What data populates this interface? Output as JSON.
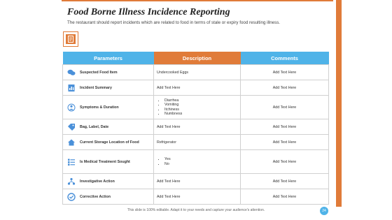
{
  "title": "Food Borne Illness Incidence Reporting",
  "subtitle": "The restaurant should report incidents which are related to food in terms of stale or expiry food resulting illness.",
  "header_icon": "document-icon",
  "colors": {
    "accent_orange": "#e07b39",
    "accent_blue": "#4fb3e8"
  },
  "table": {
    "headers": {
      "parameters": "Parameters",
      "description": "Description",
      "comments": "Comments"
    },
    "rows": [
      {
        "icon": "chat-bubbles-icon",
        "parameter": "Suspected Food Item",
        "description": "Undercooked Eggs",
        "comment": "Add Text Here"
      },
      {
        "icon": "chart-document-icon",
        "parameter": "Incident Summary",
        "description": "Add Text Here",
        "comment": "Add Text Here"
      },
      {
        "icon": "medical-person-icon",
        "parameter": "Symptoms & Duration",
        "description_list": [
          "Diarrhea",
          "Vomiting",
          "Itchiness",
          "Numbness"
        ],
        "comment": "Add Text Here"
      },
      {
        "icon": "tags-icon",
        "parameter": "Bag, Label, Date",
        "description": "Add Text Here",
        "comment": "Add Text Here"
      },
      {
        "icon": "house-icon",
        "parameter": "Current Storage Location of Food",
        "description": "Refrigerator",
        "comment": "Add Text Here"
      },
      {
        "icon": "checklist-icon",
        "parameter": "Is Medical Treatment Sought",
        "description_list": [
          "Yes",
          "No"
        ],
        "comment": "Add Text Here"
      },
      {
        "icon": "people-network-icon",
        "parameter": "Investigative Action",
        "description": "Add Text Here",
        "comment": "Add Text Here"
      },
      {
        "icon": "check-gauge-icon",
        "parameter": "Corrective Action",
        "description": "Add Text Here",
        "comment": "Add Text Here"
      }
    ]
  },
  "footer": "This slide is 100% editable. Adapt it to your needs and capture your audience's attention.",
  "page_number": "24"
}
